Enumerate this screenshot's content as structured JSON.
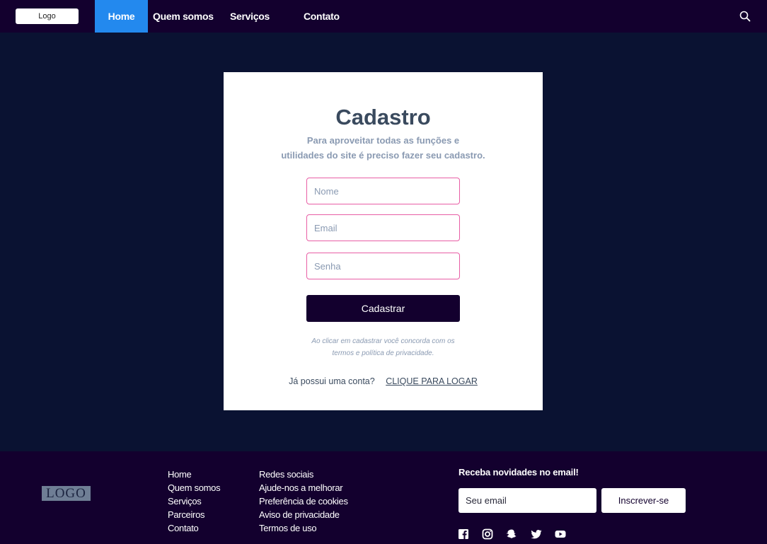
{
  "navbar": {
    "logo": "Logo",
    "items": [
      {
        "label": "Home",
        "active": true
      },
      {
        "label": "Quem somos",
        "active": false
      },
      {
        "label": "Serviços",
        "active": false
      },
      {
        "label": "Contato",
        "active": false
      }
    ],
    "search_icon": "search-icon",
    "active_color": "#2389ee",
    "bg_color": "#13002e"
  },
  "card": {
    "title": "Cadastro",
    "subtitle_line1": "Para aproveitar todas as funções e",
    "subtitle_line2": "utilidades do site é preciso fazer seu cadastro.",
    "fields": {
      "name_placeholder": "Nome",
      "email_placeholder": "Email",
      "password_placeholder": "Senha"
    },
    "submit_label": "Cadastrar",
    "terms_line1": "Ao clicar em cadastrar você concorda com os",
    "terms_line2": "termos e política de privacidade.",
    "login_prompt": "Já possui uma conta?",
    "login_link": "CLIQUE PARA LOGAR",
    "field_border_color": "#e85ea5"
  },
  "footer": {
    "logo": "LOGO",
    "col1": [
      "Home",
      "Quem somos",
      "Serviços",
      "Parceiros",
      "Contato"
    ],
    "col2": [
      "Redes sociais",
      "Ajude-nos a melhorar",
      "Preferência de cookies",
      "Aviso de privacidade",
      "Termos de uso"
    ],
    "newsletter": {
      "title": "Receba novidades no email!",
      "placeholder": "Seu email",
      "button": "Inscrever-se"
    },
    "social_icons": [
      "facebook-icon",
      "instagram-icon",
      "snapchat-icon",
      "twitter-icon",
      "youtube-icon"
    ]
  }
}
